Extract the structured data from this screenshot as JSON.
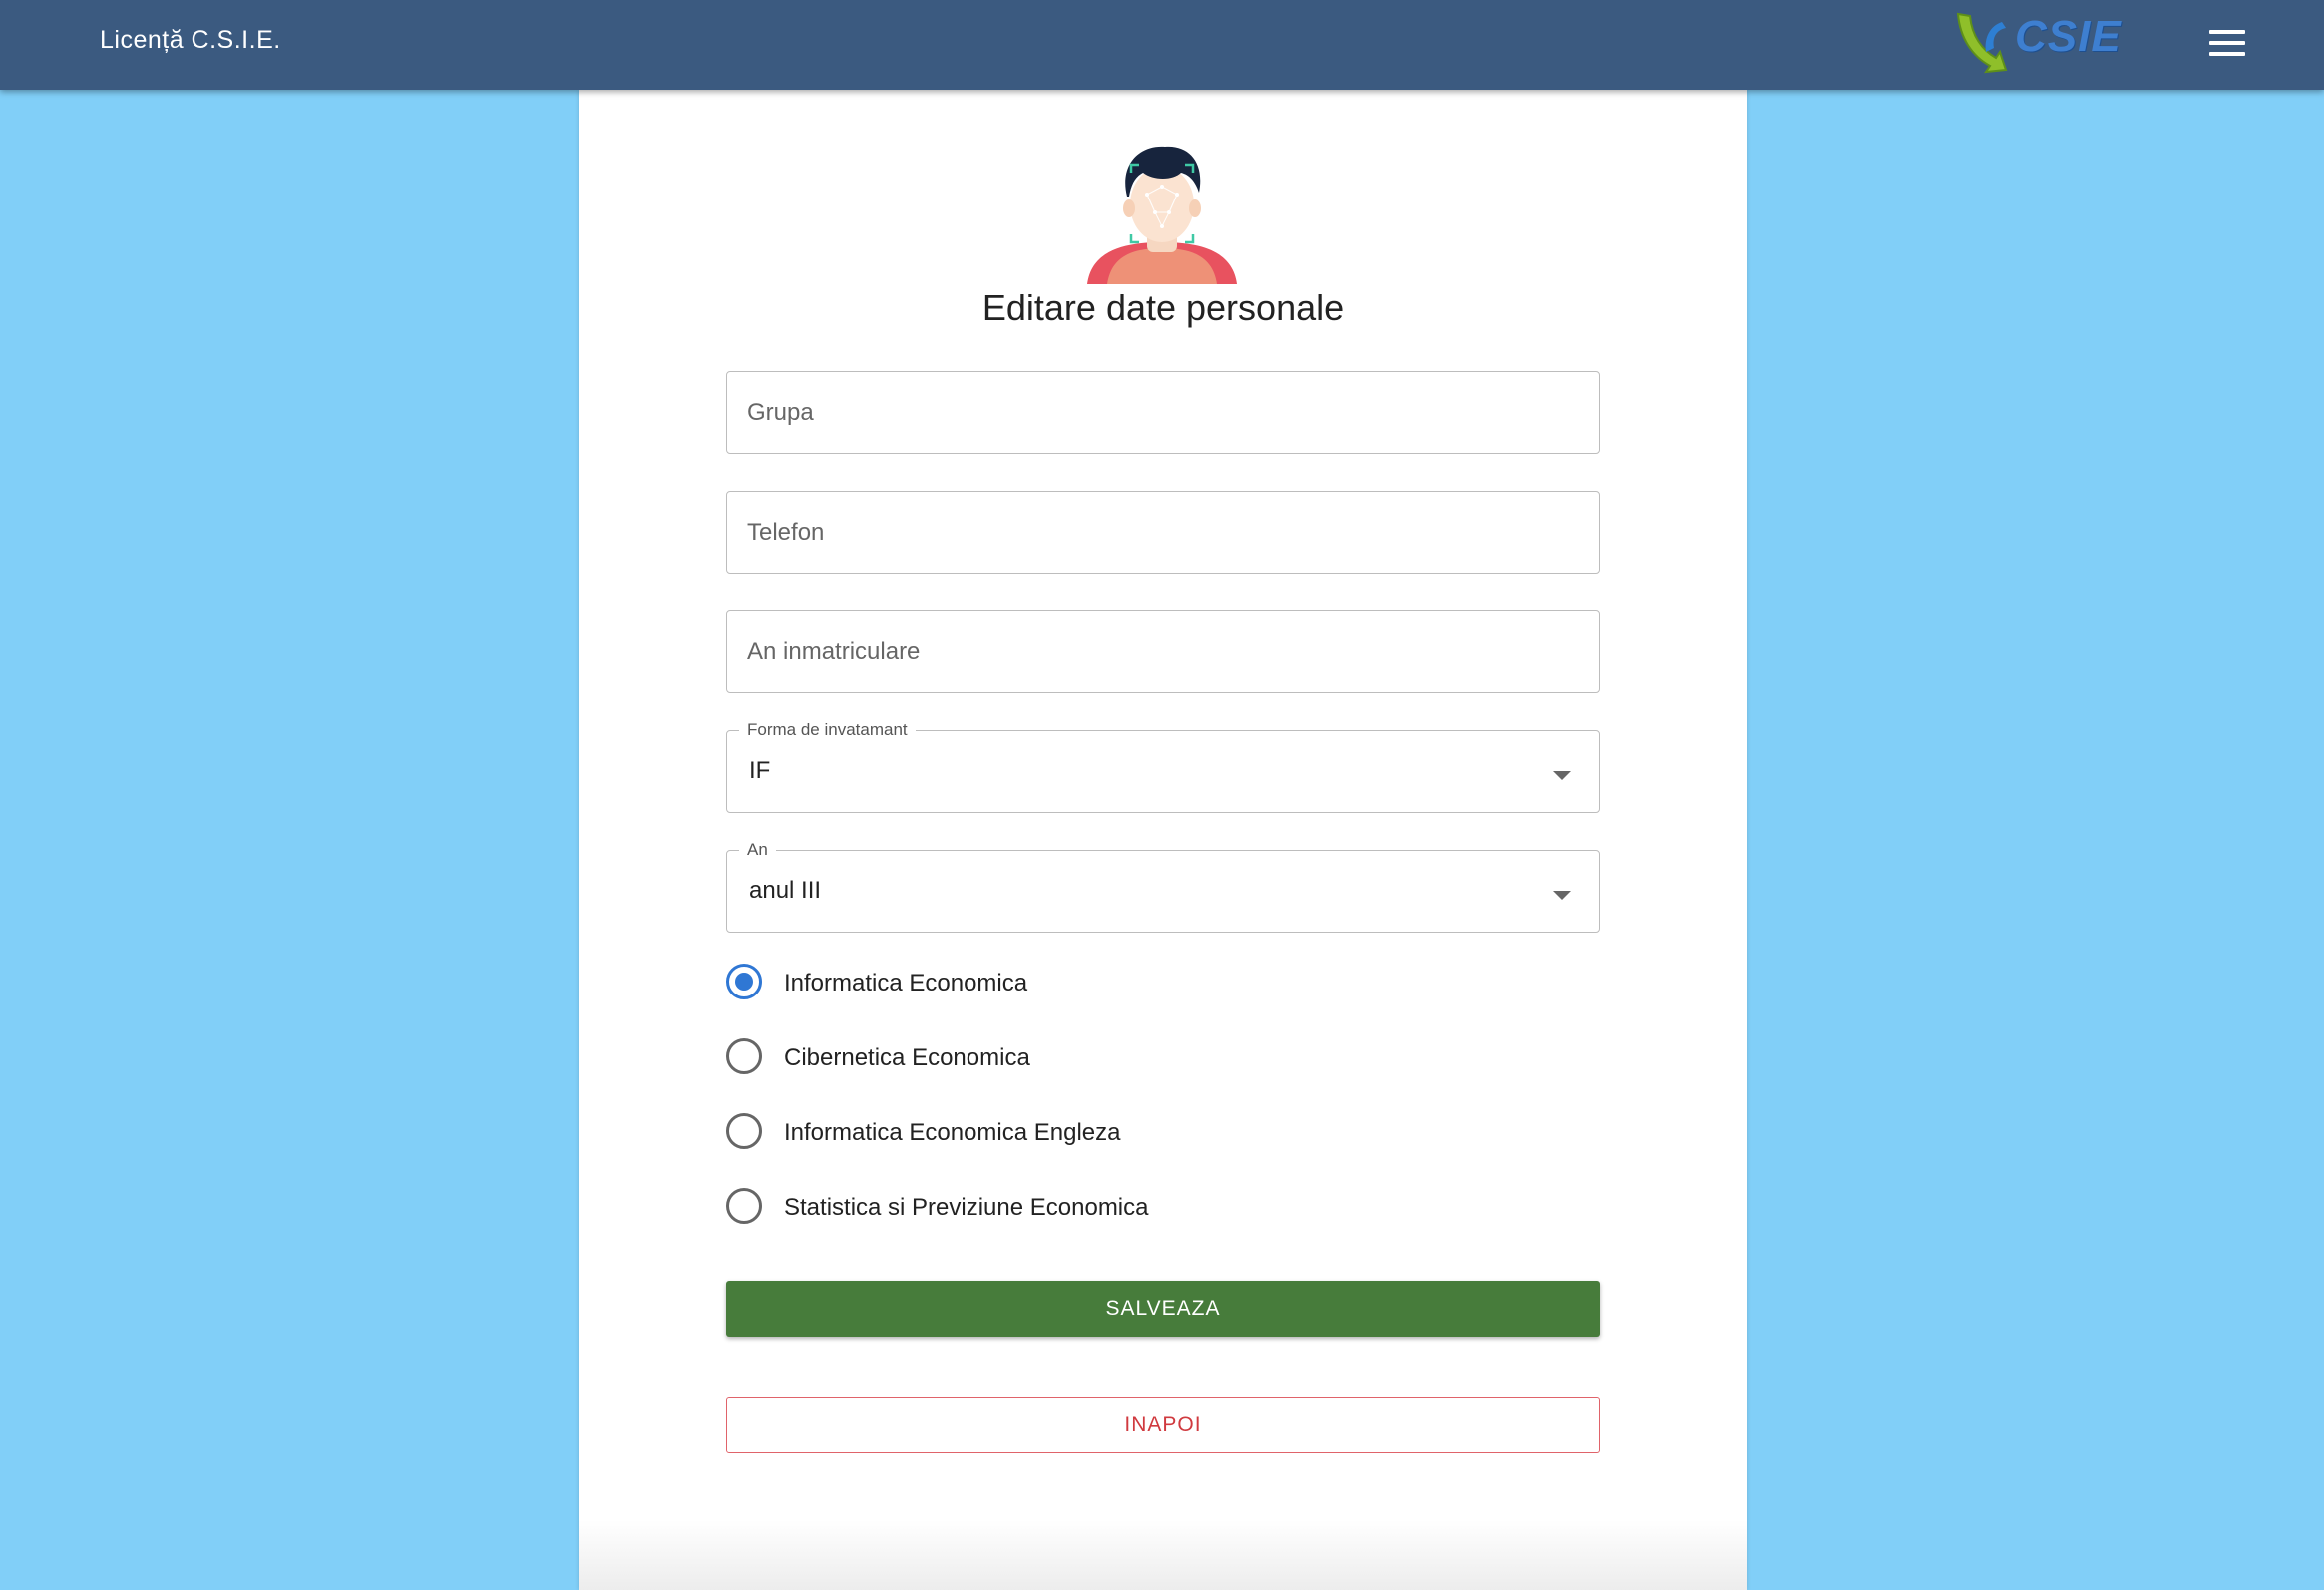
{
  "appbar": {
    "title": "Licență C.S.I.E.",
    "logo_text": "CSIE",
    "menu_icon": "hamburger-menu-icon"
  },
  "form": {
    "title": "Editare date personale",
    "avatar_icon": "face-recognition-avatar-icon",
    "grupa_placeholder": "Grupa",
    "grupa_value": "",
    "telefon_placeholder": "Telefon",
    "telefon_value": "",
    "an_inmatriculare_placeholder": "An inmatriculare",
    "an_inmatriculare_value": "",
    "forma_label": "Forma de invatamant",
    "forma_value": "IF",
    "an_label": "An",
    "an_value": "anul III",
    "specializari": [
      {
        "label": "Informatica Economica",
        "checked": true
      },
      {
        "label": "Cibernetica Economica",
        "checked": false
      },
      {
        "label": "Informatica Economica Engleza",
        "checked": false
      },
      {
        "label": "Statistica si Previziune Economica",
        "checked": false
      }
    ],
    "save_label": "SALVEAZA",
    "back_label": "INAPOI"
  },
  "colors": {
    "appbar": "#3b5a80",
    "background": "#81cff8",
    "save_button": "#477c3b",
    "back_button_text": "#d03a3f",
    "radio_accent": "#2f77d4"
  }
}
